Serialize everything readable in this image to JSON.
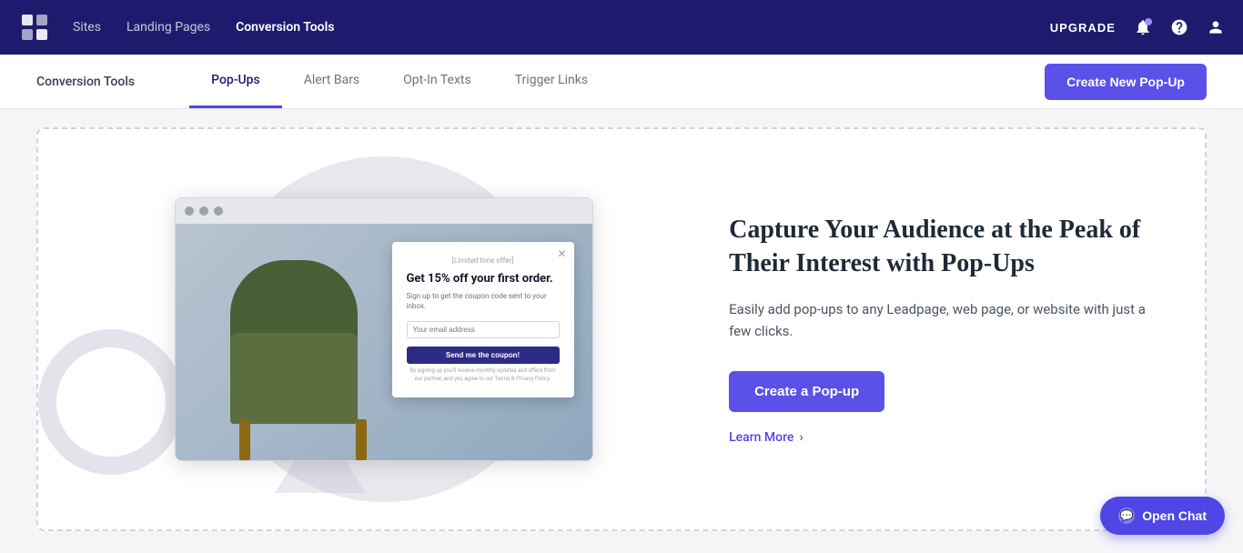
{
  "topNav": {
    "links": [
      {
        "id": "sites",
        "label": "Sites",
        "active": false
      },
      {
        "id": "landing-pages",
        "label": "Landing Pages",
        "active": false
      },
      {
        "id": "conversion-tools",
        "label": "Conversion Tools",
        "active": true
      }
    ],
    "upgradeLabel": "UPGRADE"
  },
  "subNav": {
    "title": "Conversion Tools",
    "tabs": [
      {
        "id": "pop-ups",
        "label": "Pop-Ups",
        "active": true
      },
      {
        "id": "alert-bars",
        "label": "Alert Bars",
        "active": false
      },
      {
        "id": "opt-in-texts",
        "label": "Opt-In Texts",
        "active": false
      },
      {
        "id": "trigger-links",
        "label": "Trigger Links",
        "active": false
      }
    ],
    "createButton": "Create New Pop-Up"
  },
  "promoCard": {
    "heading": "Capture Your Audience at the Peak of Their Interest with Pop-Ups",
    "description": "Easily add pop-ups to any Leadpage, web page, or website with just a few clicks.",
    "createButton": "Create a Pop-up",
    "learnMore": "Learn More"
  },
  "popup": {
    "limitedOffer": "[Limited time offer]",
    "title": "Get 15% off your first order.",
    "subtitle": "Sign up to get the coupon code sent to your inbox.",
    "inputPlaceholder": "Your email address",
    "ctaButton": "Send me the coupon!",
    "finePrint": "By signing up you'll receive monthly updates and offers from our partner, and you agree to our Terms & Privacy Policy."
  },
  "openChat": {
    "label": "Open Chat"
  }
}
